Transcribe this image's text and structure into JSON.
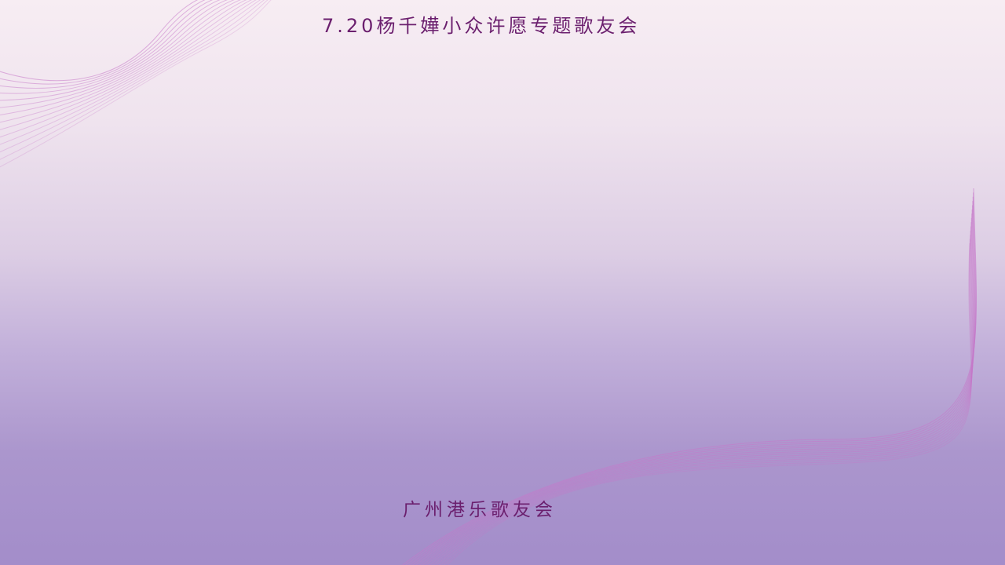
{
  "slide": {
    "title": "7.20杨千嬅小众许愿专题歌友会",
    "footer": "广州港乐歌友会"
  },
  "colors": {
    "text": "#6b1f6e",
    "wave_stroke": "#c678c9",
    "background_top": "#f7edf3",
    "background_bottom": "#a38dca"
  },
  "decorations": {
    "top_left": "pink-line-wave-decoration",
    "bottom_right": "pink-line-wave-decoration"
  }
}
